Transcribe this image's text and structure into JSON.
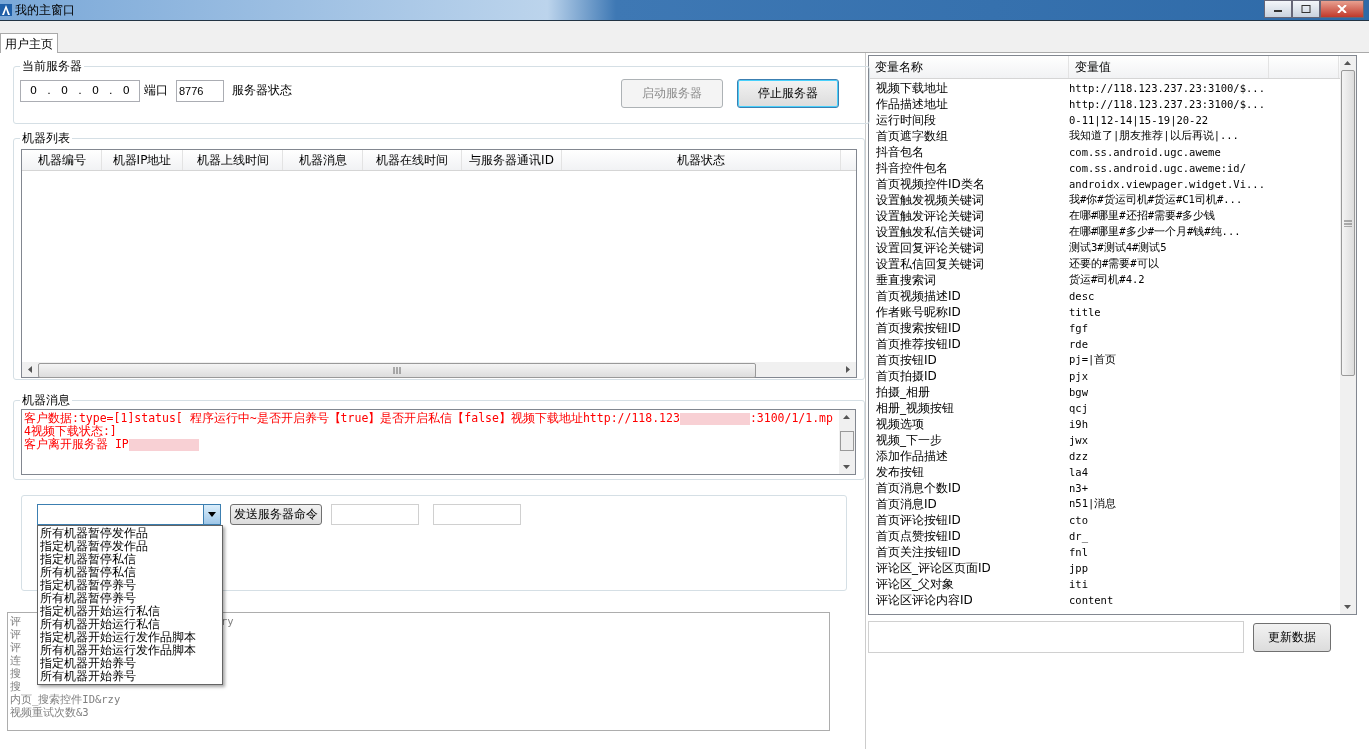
{
  "window": {
    "title": "我的主窗口"
  },
  "tabs": [
    {
      "label": "用户主页",
      "selected": true
    }
  ],
  "server": {
    "title": "当前服务器",
    "ip": [
      "0",
      "0",
      "0",
      "0"
    ],
    "ip_separator": ".",
    "port_label": "端口",
    "port": "8776",
    "status_label": "服务器状态",
    "buttons": [
      {
        "label": "启动服务器",
        "disabled": true
      },
      {
        "label": "停止服务器",
        "disabled": false
      }
    ]
  },
  "machine_list": {
    "title": "机器列表",
    "columns": [
      "机器编号",
      "机器IP地址",
      "机器上线时间",
      "机器消息",
      "机器在线时间",
      "与服务器通讯ID",
      "机器状态"
    ]
  },
  "machine_messages": {
    "title": "机器消息",
    "lines": [
      {
        "text": "客户数据:type=[1]status[ 程序运行中~是否开启养号【true】是否开启私信【false】视频下载地址http://118.123",
        "redacted": true,
        "rest": ":3100/1/1.mp4视频下载状态:]"
      },
      {
        "text": "客户离开服务器 IP",
        "redacted": true
      }
    ]
  },
  "command": {
    "send_button": "发送服务器命令",
    "options": [
      "所有机器暂停发作品",
      "指定机器暂停发作品",
      "指定机器暂停私信",
      "所有机器暂停私信",
      "指定机器暂停养号",
      "所有机器暂停养号",
      "指定机器开始运行私信",
      "所有机器开始运行私信",
      "指定机器开始运行发作品脚本",
      "所有机器开始运行发作品脚本",
      "指定机器开始养号",
      "所有机器开始养号"
    ]
  },
  "log": {
    "lines": [
      {
        "text": "评",
        "tail": "ry"
      },
      {
        "text": "评"
      },
      {
        "text": "评"
      },
      {
        "text": "连"
      },
      {
        "text": "搜"
      },
      {
        "text": "搜"
      },
      {
        "text": "内页_搜索控件ID&rzy"
      },
      {
        "text": "视频重试次数&3"
      }
    ]
  },
  "variables": {
    "columns": [
      "变量名称",
      "变量值"
    ],
    "rows": [
      {
        "name": "视频下载地址",
        "value": "http://118.123.237.23:3100/$..."
      },
      {
        "name": "作品描述地址",
        "value": "http://118.123.237.23:3100/$..."
      },
      {
        "name": "运行时间段",
        "value": "0-11|12-14|15-19|20-22"
      },
      {
        "name": "首页遮字数组",
        "value": "我知道了|朋友推荐|以后再说|..."
      },
      {
        "name": "抖音包名",
        "value": "com.ss.android.ugc.aweme"
      },
      {
        "name": "抖音控件包名",
        "value": "com.ss.android.ugc.aweme:id/"
      },
      {
        "name": "首页视频控件ID类名",
        "value": "androidx.viewpager.widget.Vi..."
      },
      {
        "name": "设置触发视频关键词",
        "value": "我#你#货运司机#货运#C1司机#..."
      },
      {
        "name": "设置触发评论关键词",
        "value": "在哪#哪里#还招#需要#多少钱"
      },
      {
        "name": "设置触发私信关键词",
        "value": "在哪#哪里#多少#一个月#钱#纯..."
      },
      {
        "name": "设置回复评论关键词",
        "value": "测试3#测试4#测试5"
      },
      {
        "name": "设置私信回复关键词",
        "value": "还要的#需要#可以"
      },
      {
        "name": "垂直搜索词",
        "value": "货运#司机#4.2"
      },
      {
        "name": "首页视频描述ID",
        "value": "desc"
      },
      {
        "name": "作者账号昵称ID",
        "value": "title"
      },
      {
        "name": "首页搜索按钮ID",
        "value": "fgf"
      },
      {
        "name": "首页推荐按钮ID",
        "value": "rde"
      },
      {
        "name": "首页按钮ID",
        "value": "pj=|首页"
      },
      {
        "name": "首页拍摄ID",
        "value": "pjx"
      },
      {
        "name": "拍摄_相册",
        "value": "bgw"
      },
      {
        "name": "相册_视频按钮",
        "value": "qcj"
      },
      {
        "name": "视频选项",
        "value": "i9h"
      },
      {
        "name": "视频_下一步",
        "value": "jwx"
      },
      {
        "name": "添加作品描述",
        "value": "dzz"
      },
      {
        "name": "发布按钮",
        "value": "la4"
      },
      {
        "name": "首页消息个数ID",
        "value": "n3+"
      },
      {
        "name": "首页消息ID",
        "value": "n51|消息"
      },
      {
        "name": "首页评论按钮ID",
        "value": "cto"
      },
      {
        "name": "首页点赞按钮ID",
        "value": "dr_"
      },
      {
        "name": "首页关注按钮ID",
        "value": "fnl"
      },
      {
        "name": "评论区_评论区页面ID",
        "value": "jpp"
      },
      {
        "name": "评论区_父对象",
        "value": "iti"
      },
      {
        "name": "评论区评论内容ID",
        "value": "content"
      }
    ]
  },
  "update_button": "更新数据"
}
